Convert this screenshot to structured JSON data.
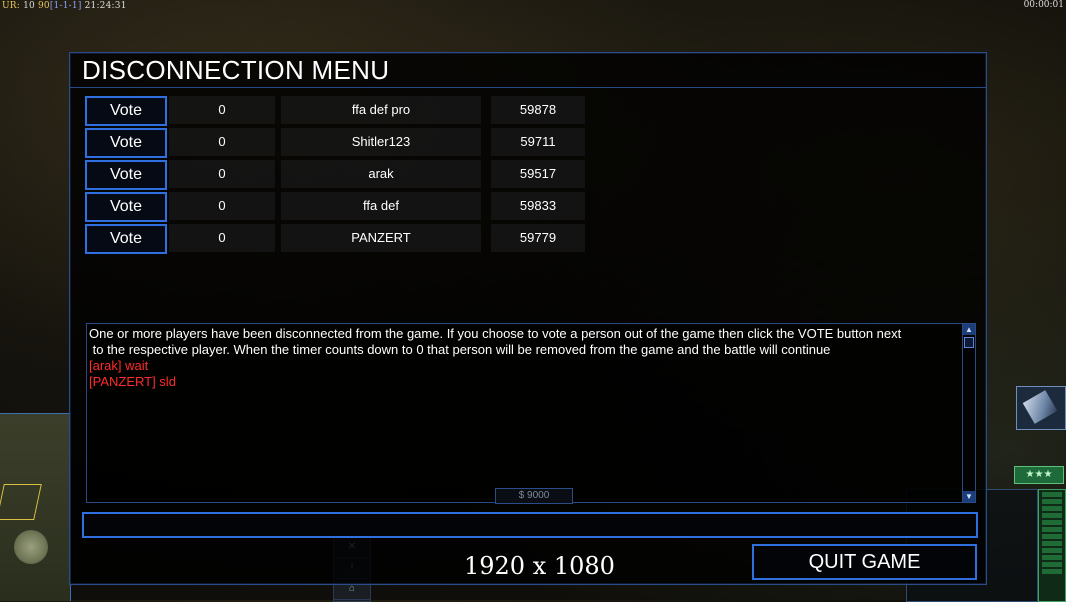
{
  "hud": {
    "ur_label": "UR:",
    "num1": "10",
    "num2": "90",
    "bracket": "[1-1-1]",
    "clock": "21:24:31",
    "game_timer": "00:00:01",
    "money": "$ 9000",
    "rank_stars": "★★★"
  },
  "dialog": {
    "title": "DISCONNECTION MENU",
    "vote_label": "Vote",
    "players": [
      {
        "votes": "0",
        "name": "ffa def pro",
        "id": "59878"
      },
      {
        "votes": "0",
        "name": "Shitler123",
        "id": "59711"
      },
      {
        "votes": "0",
        "name": "arak",
        "id": "59517"
      },
      {
        "votes": "0",
        "name": "ffa def",
        "id": "59833"
      },
      {
        "votes": "0",
        "name": "PANZERT",
        "id": "59779"
      }
    ],
    "info_line1": "One or more players have been disconnected from the game. If you choose to vote a person out of the game then click the VOTE button next",
    "info_line2": " to the respective player. When the timer counts down to 0 that person will be removed from the game and the battle will continue",
    "chat": [
      {
        "text": "[arak] wait"
      },
      {
        "text": "[PANZERT] sld"
      }
    ],
    "quit_label": "QUIT GAME"
  },
  "resolution_label": "1920 x 1080",
  "colors": {
    "accent_blue": "#2f6fe0",
    "chat_red": "#ff2b2b"
  }
}
